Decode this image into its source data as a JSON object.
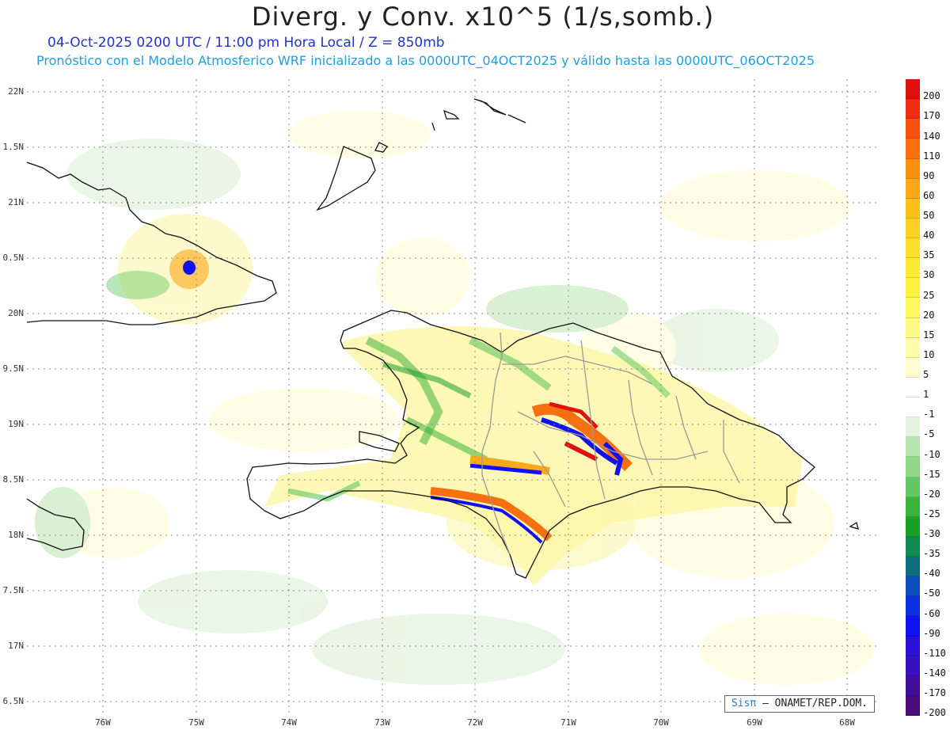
{
  "title": "Diverg. y Conv. x10^5 (1/s,somb.)",
  "subtitle_time": "04-Oct-2025  0200 UTC / 11:00 pm Hora Local / Z = 850mb",
  "subtitle_model": "Pronóstico con el Modelo Atmosferico WRF inicializado a las 0000UTC_04OCT2025 y válido hasta las  0000UTC_06OCT2025",
  "credit": {
    "brand": "Sisπ",
    "text": "– ONAMET/REP.DOM."
  },
  "lat_labels": [
    {
      "text": "22N",
      "value": 22.0
    },
    {
      "text": "1.5N",
      "value": 21.5
    },
    {
      "text": "21N",
      "value": 21.0
    },
    {
      "text": "0.5N",
      "value": 20.5
    },
    {
      "text": "20N",
      "value": 20.0
    },
    {
      "text": "9.5N",
      "value": 19.5
    },
    {
      "text": "19N",
      "value": 19.0
    },
    {
      "text": "8.5N",
      "value": 18.5
    },
    {
      "text": "18N",
      "value": 18.0
    },
    {
      "text": "7.5N",
      "value": 17.5
    },
    {
      "text": "17N",
      "value": 17.0
    },
    {
      "text": "6.5N",
      "value": 16.5
    }
  ],
  "lon_labels": [
    {
      "text": "76W",
      "value": -76
    },
    {
      "text": "75W",
      "value": -75
    },
    {
      "text": "74W",
      "value": -74
    },
    {
      "text": "73W",
      "value": -73
    },
    {
      "text": "72W",
      "value": -72
    },
    {
      "text": "71W",
      "value": -71
    },
    {
      "text": "70W",
      "value": -70
    },
    {
      "text": "69W",
      "value": -69
    },
    {
      "text": "68W",
      "value": -68
    }
  ],
  "colorbar": [
    {
      "label": "200",
      "color": "#e01010"
    },
    {
      "label": "170",
      "color": "#f02c10"
    },
    {
      "label": "140",
      "color": "#f85010"
    },
    {
      "label": "110",
      "color": "#fa7010"
    },
    {
      "label": "90",
      "color": "#fb9010"
    },
    {
      "label": "60",
      "color": "#fca818"
    },
    {
      "label": "50",
      "color": "#fcc018"
    },
    {
      "label": "40",
      "color": "#fcd020"
    },
    {
      "label": "35",
      "color": "#fce028"
    },
    {
      "label": "30",
      "color": "#fceb30"
    },
    {
      "label": "25",
      "color": "#fdf240"
    },
    {
      "label": "20",
      "color": "#fdf760"
    },
    {
      "label": "15",
      "color": "#fdf985"
    },
    {
      "label": "10",
      "color": "#fefbaa"
    },
    {
      "label": "5",
      "color": "#fffdd0"
    },
    {
      "label": "1",
      "color": "#ffffff"
    },
    {
      "label": "-1",
      "color": "#ffffff"
    },
    {
      "label": "-5",
      "color": "#e4f4e0"
    },
    {
      "label": "-10",
      "color": "#b8e6b0"
    },
    {
      "label": "-15",
      "color": "#8fd888"
    },
    {
      "label": "-20",
      "color": "#62c862"
    },
    {
      "label": "-25",
      "color": "#3cb43c"
    },
    {
      "label": "-30",
      "color": "#18a028"
    },
    {
      "label": "-35",
      "color": "#108a50"
    },
    {
      "label": "-40",
      "color": "#0c6e80"
    },
    {
      "label": "-50",
      "color": "#0a4cb8"
    },
    {
      "label": "-60",
      "color": "#0a30e0"
    },
    {
      "label": "-90",
      "color": "#1010f0"
    },
    {
      "label": "-110",
      "color": "#2a10d8"
    },
    {
      "label": "-140",
      "color": "#3810c0"
    },
    {
      "label": "-170",
      "color": "#400e9a"
    },
    {
      "label": "-200",
      "color": "#4a0a7a"
    }
  ]
}
